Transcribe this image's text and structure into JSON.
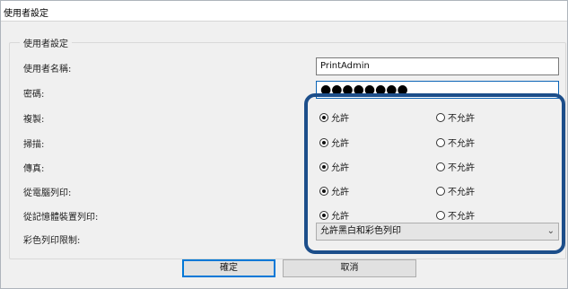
{
  "window": {
    "title": "使用者設定"
  },
  "group": {
    "legend": "使用者設定"
  },
  "fields": {
    "username": {
      "label": "使用者名稱:",
      "value": "PrintAdmin"
    },
    "password": {
      "label": "密碼:",
      "value": "●●●●●●●●"
    }
  },
  "permissions": {
    "allow_label": "允許",
    "deny_label": "不允許",
    "rows": [
      {
        "label": "複製:",
        "selected": "allow"
      },
      {
        "label": "掃描:",
        "selected": "allow"
      },
      {
        "label": "傳真:",
        "selected": "allow"
      },
      {
        "label": "從電腦列印:",
        "selected": "allow"
      },
      {
        "label": "從記憶體裝置列印:",
        "selected": "allow"
      }
    ]
  },
  "color_restriction": {
    "label": "彩色列印限制:",
    "selected": "允許黑白和彩色列印"
  },
  "buttons": {
    "ok": "確定",
    "cancel": "取消"
  },
  "colors": {
    "highlight_border": "#1c4e8a",
    "focus_border": "#0078d7"
  }
}
